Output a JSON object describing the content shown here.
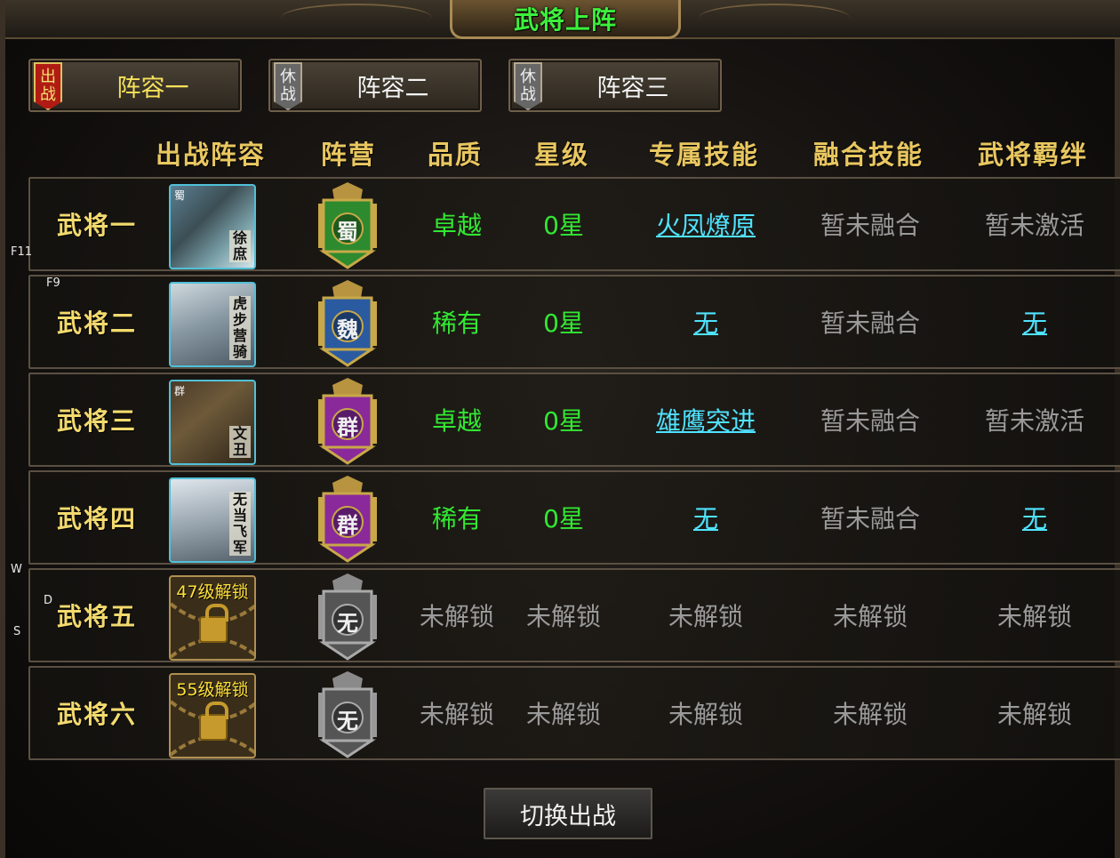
{
  "title": "武将上阵",
  "tabs": [
    {
      "flag_top": "出",
      "flag_bottom": "战",
      "label": "阵容一",
      "active": true
    },
    {
      "flag_top": "休",
      "flag_bottom": "战",
      "label": "阵容二",
      "active": false
    },
    {
      "flag_top": "休",
      "flag_bottom": "战",
      "label": "阵容三",
      "active": false
    }
  ],
  "columns": [
    "出战阵容",
    "阵营",
    "品质",
    "星级",
    "专属技能",
    "融合技能",
    "武将羁绊"
  ],
  "rows": [
    {
      "name": "武将一",
      "portrait_name": "徐庶",
      "portrait_tag": "蜀",
      "faction": "蜀",
      "quality": "卓越",
      "stars": "0星",
      "skill": "火凤燎原",
      "fusion": "暂未融合",
      "bond": "暂未激活"
    },
    {
      "name": "武将二",
      "portrait_name": "虎步营骑",
      "portrait_tag": "",
      "faction": "魏",
      "quality": "稀有",
      "stars": "0星",
      "skill": "无",
      "fusion": "暂未融合",
      "bond": "无"
    },
    {
      "name": "武将三",
      "portrait_name": "文丑",
      "portrait_tag": "群",
      "faction": "群",
      "quality": "卓越",
      "stars": "0星",
      "skill": "雄鹰突进",
      "fusion": "暂未融合",
      "bond": "暂未激活"
    },
    {
      "name": "武将四",
      "portrait_name": "无当飞军",
      "portrait_tag": "",
      "faction": "群",
      "quality": "稀有",
      "stars": "0星",
      "skill": "无",
      "fusion": "暂未融合",
      "bond": "无"
    },
    {
      "name": "武将五",
      "unlock": "47级解锁",
      "faction": "无",
      "quality": "未解锁",
      "stars": "未解锁",
      "skill": "未解锁",
      "fusion": "未解锁",
      "bond": "未解锁"
    },
    {
      "name": "武将六",
      "unlock": "55级解锁",
      "faction": "无",
      "quality": "未解锁",
      "stars": "未解锁",
      "skill": "未解锁",
      "fusion": "未解锁",
      "bond": "未解锁"
    }
  ],
  "switch_button": "切换出战",
  "hotkeys": [
    "F11",
    "F9",
    "W",
    "D",
    "S"
  ],
  "colors": {
    "title": "#3cf03c",
    "name": "#f3da6e",
    "quality": "#32e832",
    "link": "#4fe3ff",
    "muted": "#9a9a9a",
    "shu": "#2e8a2e",
    "wei": "#2a5aa0",
    "qun": "#8a2a9a",
    "none": "#777777"
  }
}
